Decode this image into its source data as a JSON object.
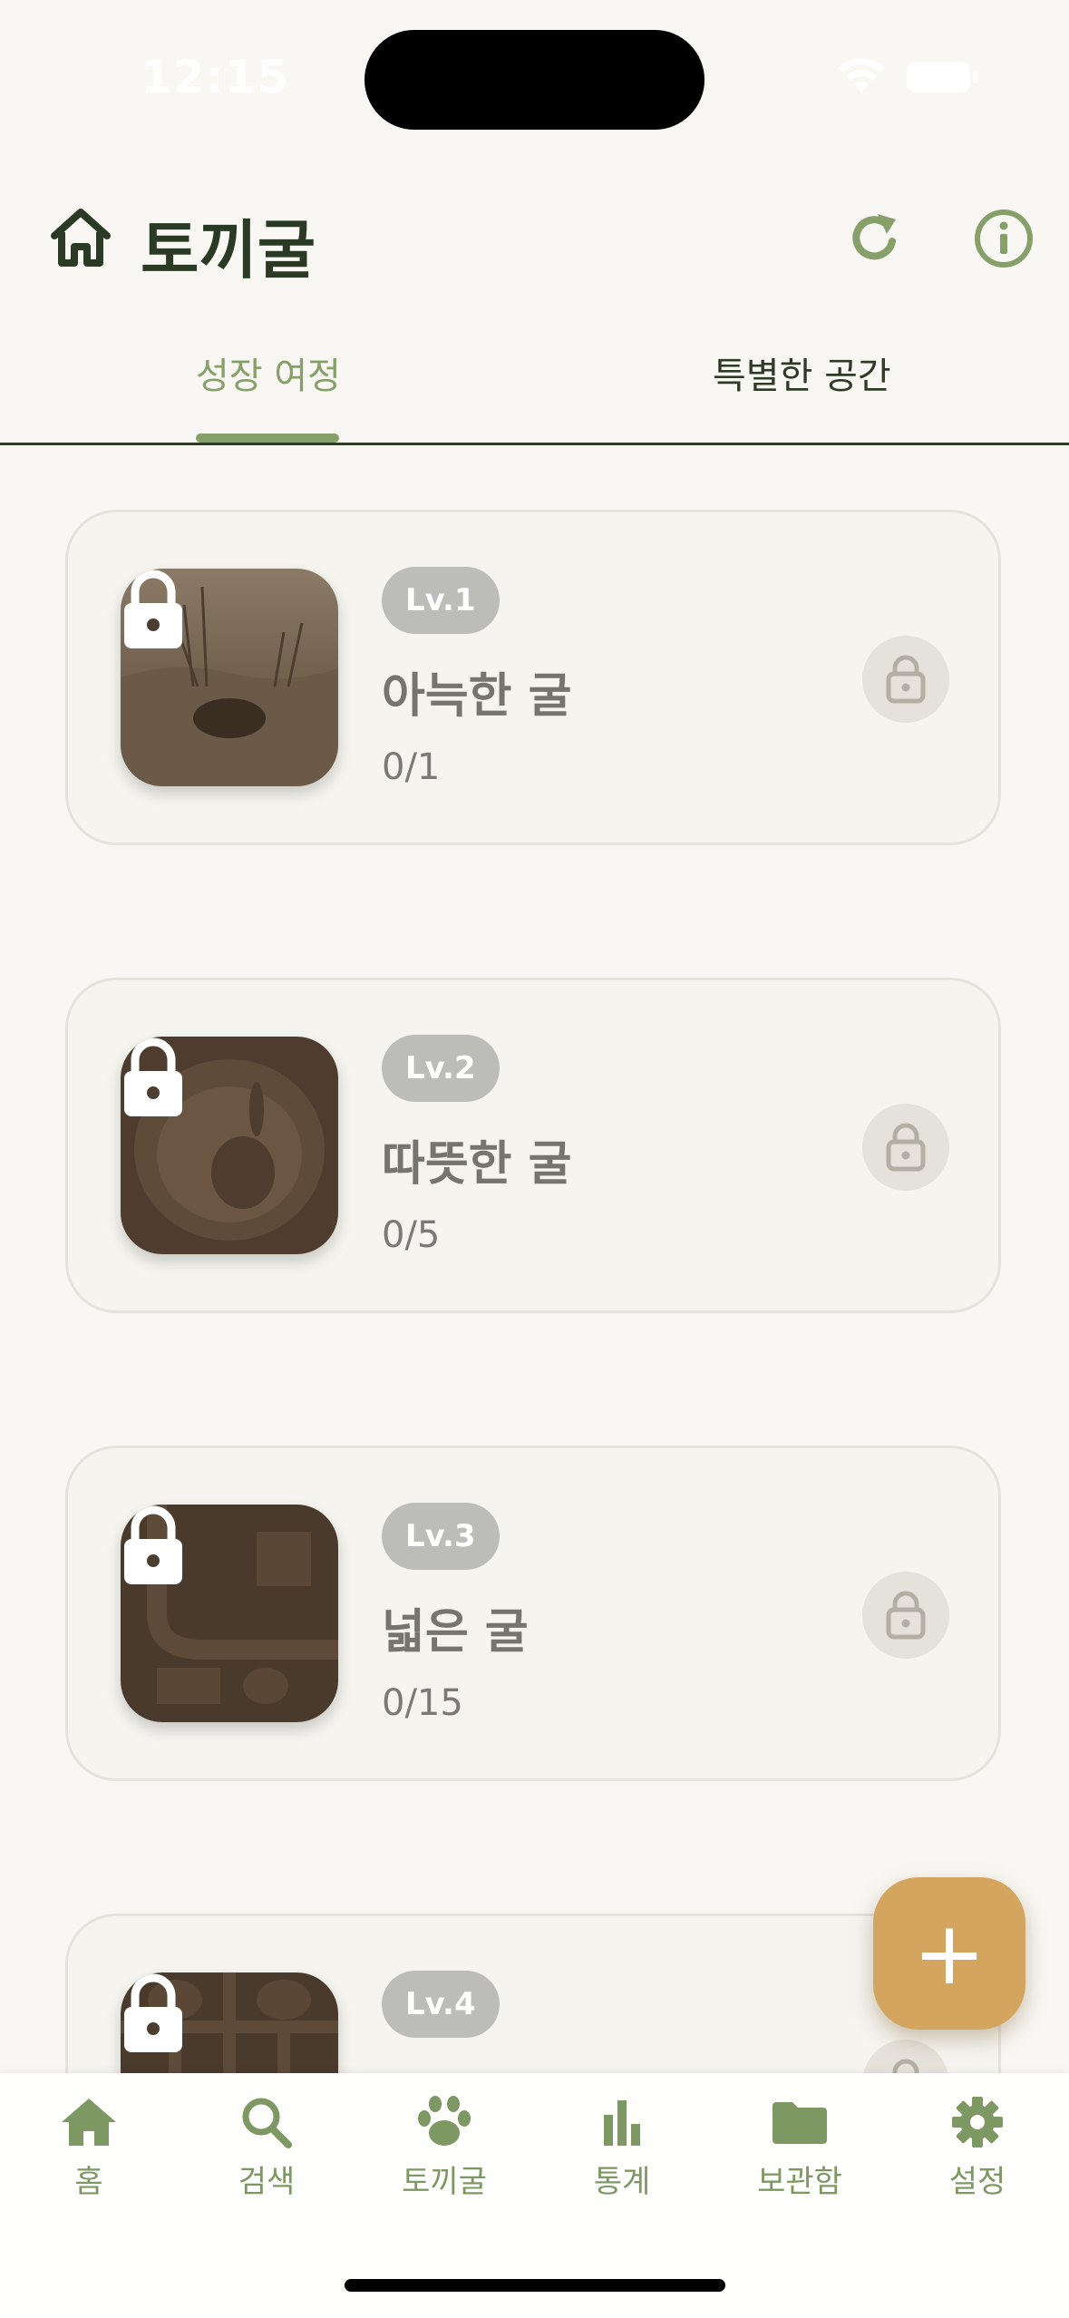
{
  "status_bar": {
    "time": "12:15"
  },
  "header": {
    "title": "토끼굴",
    "icons": [
      "home-icon",
      "refresh-icon",
      "info-icon"
    ]
  },
  "tabs": [
    {
      "label": "성장 여정",
      "selected": true
    },
    {
      "label": "특별한 공간",
      "selected": false
    }
  ],
  "cards": [
    {
      "level": "Lv.1",
      "name": "아늑한 굴",
      "progress": "0/1",
      "locked": true
    },
    {
      "level": "Lv.2",
      "name": "따뜻한 굴",
      "progress": "0/5",
      "locked": true
    },
    {
      "level": "Lv.3",
      "name": "넓은 굴",
      "progress": "0/15",
      "locked": true
    },
    {
      "level": "Lv.4",
      "name": "",
      "progress": "",
      "locked": true
    }
  ],
  "fab": {
    "label": "+"
  },
  "bottom_nav": {
    "items": [
      {
        "label": "홈",
        "icon": "home-icon"
      },
      {
        "label": "검색",
        "icon": "search-icon"
      },
      {
        "label": "토끼굴",
        "icon": "paw-icon"
      },
      {
        "label": "통계",
        "icon": "bar-chart-icon"
      },
      {
        "label": "보관함",
        "icon": "folder-icon"
      },
      {
        "label": "설정",
        "icon": "gear-icon"
      }
    ]
  },
  "colors": {
    "background": "#f8f7f3",
    "accent_green": "#87a06a",
    "dark_green": "#2b3a24",
    "fab": "#d4a55f",
    "badge": "#bcbcb9"
  }
}
